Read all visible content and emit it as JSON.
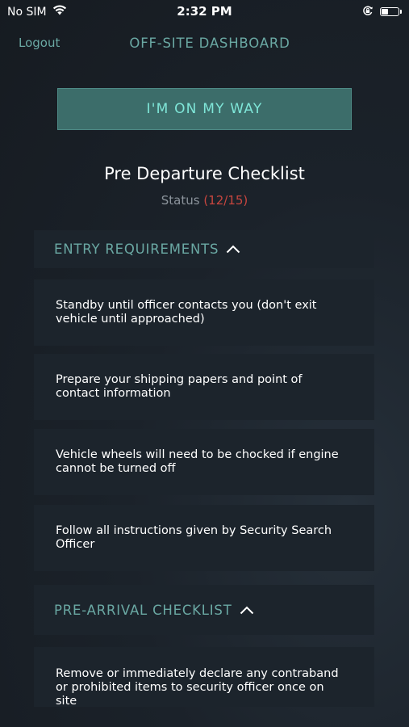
{
  "status_bar": {
    "carrier": "No SIM",
    "time": "2:32 PM",
    "wifi_icon": "wifi-icon",
    "orientation_lock_icon": "orientation-lock-icon",
    "battery_icon": "battery-icon"
  },
  "nav": {
    "logout_label": "Logout",
    "title": "OFF-SITE DASHBOARD"
  },
  "primary_button": {
    "label": "I'M ON MY WAY"
  },
  "checklist": {
    "title": "Pre Departure Checklist",
    "status_label": "Status",
    "status_count": "(12/15)"
  },
  "sections": [
    {
      "title": "ENTRY REQUIREMENTS",
      "expanded_icon": "chevron-up-icon",
      "items": [
        "Standby until officer contacts you (don't exit vehicle until approached)",
        "Prepare your shipping papers and point of contact information",
        "Vehicle wheels will need to be chocked if engine cannot be turned off",
        "Follow all instructions given by Security Search Officer"
      ]
    },
    {
      "title": "PRE-ARRIVAL CHECKLIST",
      "expanded_icon": "chevron-up-icon",
      "items": [
        "Remove or immediately declare any contraband or prohibited items to security officer once on site"
      ]
    }
  ],
  "colors": {
    "accent": "#6aa8a3",
    "button_bg": "#3c6d6a",
    "button_text": "#7fe6d8",
    "status_count": "#c8463f",
    "card_bg": "#1c242c"
  }
}
